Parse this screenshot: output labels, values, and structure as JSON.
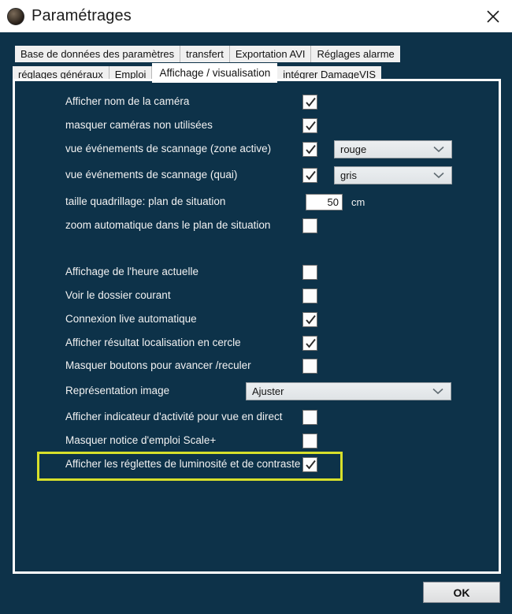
{
  "window": {
    "title": "Paramétrages",
    "icon": "camera-globe-icon",
    "close_label": "✕",
    "bg_color": "#0d3249",
    "titlebar_color": "#ffffff",
    "highlight_color": "#d7e02b"
  },
  "tabs": {
    "row1": [
      {
        "label": "Base de données des paramètres",
        "active": false
      },
      {
        "label": "transfert",
        "active": false
      },
      {
        "label": "Exportation AVI",
        "active": false
      },
      {
        "label": "Réglages alarme",
        "active": false
      }
    ],
    "row2": [
      {
        "label": "réglages généraux",
        "active": false
      },
      {
        "label": "Emploi",
        "active": false
      },
      {
        "label": "Affichage / visualisation",
        "active": true
      },
      {
        "label": "intégrer DamageVIS",
        "active": false
      }
    ]
  },
  "settings": {
    "group1": [
      {
        "label": "Afficher nom de la caméra",
        "type": "checkbox",
        "checked": true
      },
      {
        "label": "masquer caméras non utilisées",
        "type": "checkbox",
        "checked": true
      },
      {
        "label": "vue événements de scannage (zone active)",
        "type": "checkbox",
        "checked": true,
        "dropdown": "rouge"
      },
      {
        "label": "vue événements de scannage (quai)",
        "type": "checkbox",
        "checked": true,
        "dropdown": "gris"
      },
      {
        "label": "taille quadrillage: plan de situation",
        "type": "number",
        "value": "50",
        "unit": "cm"
      },
      {
        "label": "zoom automatique dans le plan de situation",
        "type": "checkbox",
        "checked": false
      }
    ],
    "group2": [
      {
        "label": "Affichage de l'heure actuelle",
        "type": "checkbox",
        "checked": false
      },
      {
        "label": "Voir le dossier courant",
        "type": "checkbox",
        "checked": false
      },
      {
        "label": "Connexion live automatique",
        "type": "checkbox",
        "checked": true
      },
      {
        "label": "Afficher résultat localisation en cercle",
        "type": "checkbox",
        "checked": true
      },
      {
        "label": "Masquer boutons pour avancer /reculer",
        "type": "checkbox",
        "checked": false
      },
      {
        "label": "Représentation image",
        "type": "select",
        "value": "Ajuster"
      },
      {
        "label": "Afficher indicateur d'activité  pour vue en direct",
        "type": "checkbox",
        "checked": false
      },
      {
        "label": "Masquer notice d'emploi Scale+",
        "type": "checkbox",
        "checked": false
      },
      {
        "label": "Afficher les réglettes de luminosité et de contraste",
        "type": "checkbox",
        "checked": true,
        "highlighted": true
      }
    ]
  },
  "footer": {
    "ok_label": "OK"
  }
}
